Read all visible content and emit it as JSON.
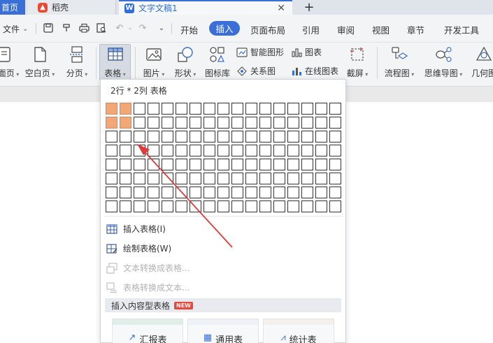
{
  "tabs": {
    "home_label": "首页",
    "daoke_label": "稻壳",
    "doc_label": "文字文稿1",
    "close_glyph": "✕",
    "add_glyph": "+"
  },
  "menubar": {
    "file_label": "文件",
    "items": [
      "开始",
      "插入",
      "页面布局",
      "引用",
      "审阅",
      "视图",
      "章节",
      "开发工具"
    ],
    "active_index": 1
  },
  "ribbon": {
    "buttons": {
      "cover_page": "封面页",
      "blank_page": "空白页",
      "page_break": "分页",
      "table": "表格",
      "picture": "图片",
      "shape": "形状",
      "icon_library": "图标库",
      "smart_shape": "智能图形",
      "chart": "图表",
      "relation_chart": "关系图",
      "online_chart": "在线图表",
      "screenshot": "截屏",
      "flowchart": "流程图",
      "mindmap": "思维导图",
      "geometry": "几何图"
    }
  },
  "table_dropdown": {
    "size_label": "2行 * 2列 表格",
    "grid_rows": 8,
    "grid_cols": 17,
    "selected_rows": 2,
    "selected_cols": 2,
    "items": {
      "insert_table": "插入表格(I)",
      "draw_table": "绘制表格(W)",
      "text_to_table": "文本转换成表格...",
      "table_to_text": "表格转换成文本..."
    },
    "section_label": "插入内容型表格",
    "new_badge": "NEW",
    "templates": [
      "汇报表",
      "通用表",
      "统计表"
    ]
  },
  "colors": {
    "accent": "#3b6fd8",
    "selected_cell": "#f2a876",
    "arrow": "#e03a3a",
    "new_badge": "#e5483c"
  }
}
